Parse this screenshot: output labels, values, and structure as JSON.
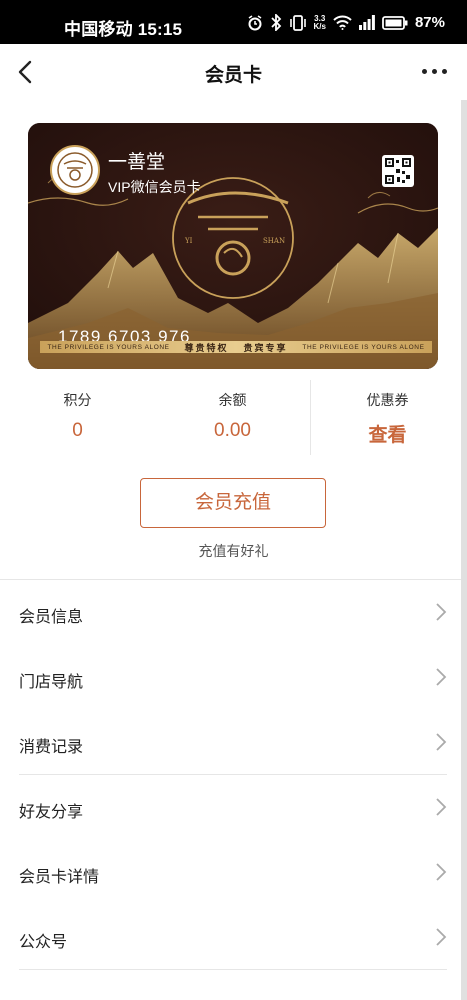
{
  "status_bar": {
    "carrier_time": "中国移动 15:15",
    "net_speed_value": "3.3",
    "net_speed_unit": "K/s",
    "battery": "87%",
    "icons": [
      "alarm-icon",
      "bluetooth-icon",
      "vibrate-icon",
      "wifi-icon",
      "signal-icon",
      "battery-icon"
    ]
  },
  "nav": {
    "title": "会员卡"
  },
  "card": {
    "brand_name": "一善堂",
    "subtitle": "VIP微信会员卡",
    "number": "1789 6703 976",
    "logo_left": "YI",
    "logo_right": "SHAN",
    "strip_left": "THE PRIVILEGE IS YOURS ALONE",
    "strip_mid_1": "尊贵特权",
    "strip_mid_2": "贵宾专享",
    "strip_right": "THE PRIVILEGE IS YOURS ALONE"
  },
  "stats": {
    "points_label": "积分",
    "points_value": "0",
    "balance_label": "余额",
    "balance_value": "0.00",
    "coupon_label": "优惠券",
    "coupon_action": "查看"
  },
  "recharge": {
    "button_label": "会员充值",
    "tip": "充值有好礼"
  },
  "menu": [
    {
      "label": "会员信息"
    },
    {
      "label": "门店导航"
    },
    {
      "label": "消费记录"
    },
    {
      "label": "好友分享"
    },
    {
      "label": "会员卡详情"
    },
    {
      "label": "公众号"
    }
  ],
  "colors": {
    "accent": "#c8663b",
    "card_bg": "#2a1410",
    "gold": "#c9a15a"
  }
}
